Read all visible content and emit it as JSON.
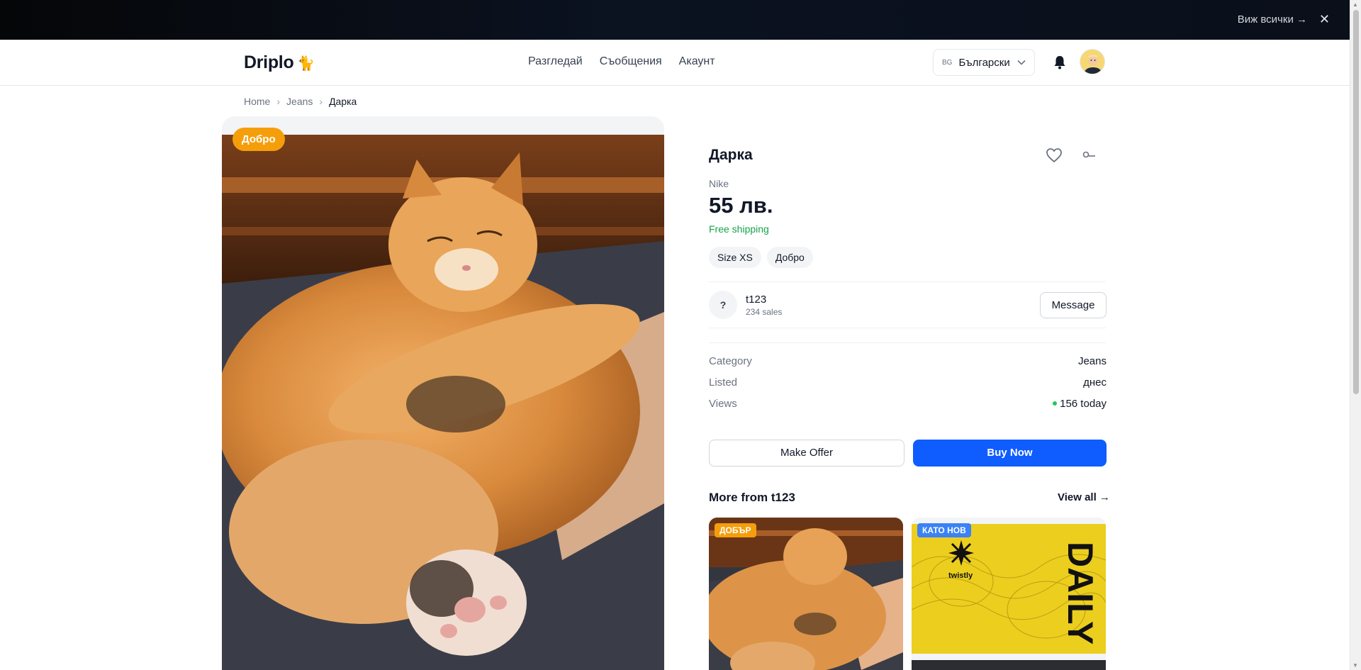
{
  "promo_bar": {
    "view_all": "Виж всички →",
    "close": "✕"
  },
  "header": {
    "logo": "Driplo",
    "logo_emoji": "🐈",
    "nav": [
      "Разгледай",
      "Съобщения",
      "Акаунт"
    ],
    "lang_code": "BG",
    "lang_label": "Български",
    "icons": {
      "notifications": "bell-icon",
      "avatar": "avatar"
    }
  },
  "breadcrumb": [
    "Home",
    "Jeans",
    "Дарка"
  ],
  "product": {
    "condition_badge": "Добро",
    "title": "Дарка",
    "brand": "Nike",
    "price": "55 лв.",
    "shipping": "Free shipping",
    "chips": [
      "Size XS",
      "Добро"
    ],
    "colors": {
      "accent": "#0f5cff",
      "badge": "#f59e0b",
      "shipping": "#16a34a"
    }
  },
  "seller": {
    "avatar_placeholder": "?",
    "name": "t123",
    "sales": "234 sales",
    "message_label": "Message"
  },
  "details": [
    {
      "label": "Category",
      "value": "Jeans"
    },
    {
      "label": "Listed",
      "value": "днес"
    },
    {
      "label": "Views",
      "value": "156 today"
    }
  ],
  "actions": {
    "offer": "Make Offer",
    "buy": "Buy Now"
  },
  "more": {
    "title": "More from t123",
    "view_all": "View all →",
    "items": [
      {
        "badge": "ДОБЪР",
        "badge_color": "#f59e0b"
      },
      {
        "badge": "КАТО НОВ",
        "badge_color": "#3b82f6",
        "brand_text": "twistly",
        "poster_text": "DAILY"
      }
    ]
  }
}
